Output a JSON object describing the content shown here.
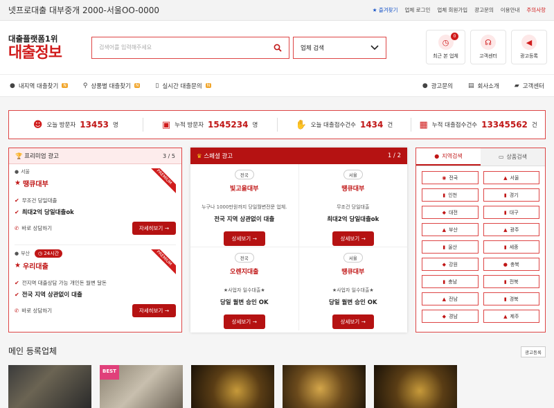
{
  "topbar": {
    "text": "넷프로대출 대부중개 2000-서울OO-0000",
    "links": [
      "즐겨찾기",
      "업체 로그인",
      "업체 회원가입",
      "광고문의",
      "이용안내",
      "주의사항"
    ]
  },
  "logo": {
    "sub": "대출플랫폼1위",
    "main": "대출정보"
  },
  "search": {
    "placeholder": "검색어를 입력해주세요",
    "select": "업체 검색"
  },
  "quick": [
    {
      "label": "최근 본 업체",
      "badge": "0"
    },
    {
      "label": "고객센터"
    },
    {
      "label": "광고등록"
    }
  ],
  "nav": {
    "left": [
      {
        "label": "내지역 대출찾기",
        "badge": "N"
      },
      {
        "label": "상품별 대출찾기",
        "badge": "N"
      },
      {
        "label": "실시간 대출문의",
        "badge": "N"
      }
    ],
    "right": [
      "광고문의",
      "회사소개",
      "고객센터"
    ]
  },
  "stats": [
    {
      "label": "오늘 방문자",
      "value": "13453",
      "unit": "명"
    },
    {
      "label": "누적 방문자",
      "value": "1545234",
      "unit": "명"
    },
    {
      "label": "오늘 대출접수건수",
      "value": "1434",
      "unit": "건"
    },
    {
      "label": "누적 대출접수건수",
      "value": "13345562",
      "unit": "건"
    }
  ],
  "premium": {
    "title": "프리미엄 광고",
    "page": "3 / 5",
    "ribbon": "PREMIUM",
    "cards": [
      {
        "loc": "서울",
        "name": "땡큐대부",
        "desc": "무조건 당일대출",
        "bold": "최대2억 당일대출ok",
        "call": "바로 상담하기",
        "btn": "자세히보기"
      },
      {
        "loc": "부산",
        "tag": "24시간",
        "name": "우리대출",
        "desc": "전지역 대출상담 가능 개인돈 월변 달돈",
        "bold": "전국 지역 상관없이 대출",
        "call": "바로 상담하기",
        "btn": "자세히보기"
      }
    ]
  },
  "special": {
    "title": "스페셜 광고",
    "page": "1 / 2",
    "cards": [
      {
        "region": "전국",
        "name": "빛고을대부",
        "desc": "누구나 1000만원까지 당일월변전문 업체.",
        "bold": "전국 지역 상관없이 대출",
        "btn": "상세보기"
      },
      {
        "region": "서울",
        "name": "땡큐대부",
        "desc": "무조건 당일대출",
        "bold": "최대2억 당일대출ok",
        "btn": "상세보기"
      },
      {
        "region": "전국",
        "name": "오렌지대출",
        "desc": "★사업자 일수대출★",
        "bold": "당일 월변 승인 OK",
        "btn": "상세보기"
      },
      {
        "region": "서울",
        "name": "땡큐대부",
        "desc": "★사업자 일수대출★",
        "bold": "당일 월변 승인 OK",
        "btn": "상세보기"
      }
    ]
  },
  "region": {
    "tabs": [
      "지역검색",
      "상품검색"
    ],
    "items": [
      "전국",
      "서울",
      "인천",
      "경기",
      "대전",
      "대구",
      "부산",
      "광주",
      "울산",
      "세종",
      "강원",
      "충북",
      "충남",
      "전북",
      "전남",
      "경북",
      "경남",
      "제주"
    ]
  },
  "main": {
    "title": "메인 등록업체",
    "ad_btn": "광고등록",
    "best": "BEST"
  }
}
